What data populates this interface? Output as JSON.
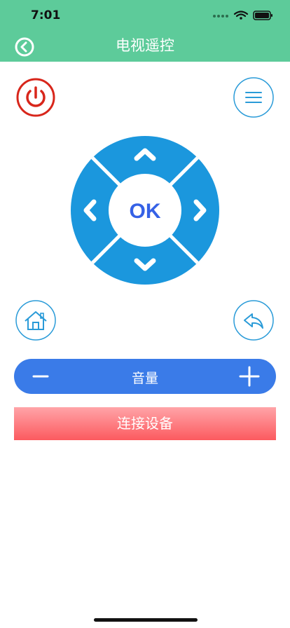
{
  "status_bar": {
    "time": "7:01"
  },
  "nav": {
    "title": "电视遥控"
  },
  "dpad": {
    "ok_label": "OK"
  },
  "volume": {
    "label": "音量"
  },
  "connect": {
    "label": "连接设备"
  },
  "colors": {
    "header": "#5dcb9a",
    "dpad": "#1b97dd",
    "ok_text": "#3561e6",
    "power": "#d8261b",
    "volume_bar": "#3a7be8",
    "connect_top": "#ffa4a8",
    "connect_bottom": "#fc5a5f"
  },
  "icons": [
    "back-icon",
    "power-icon",
    "menu-icon",
    "home-icon",
    "return-icon",
    "minus-icon",
    "plus-icon",
    "chevron-up-icon",
    "chevron-down-icon",
    "chevron-left-icon",
    "chevron-right-icon"
  ]
}
